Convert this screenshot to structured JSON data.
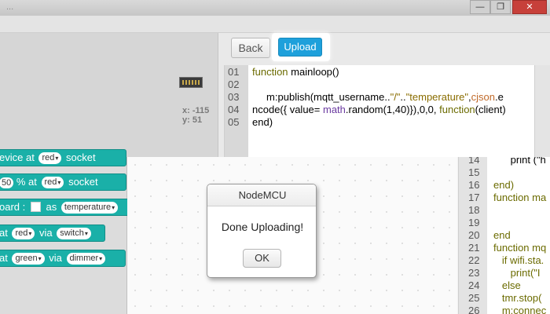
{
  "window": {
    "title": "...",
    "controls": [
      "—",
      "❐",
      "✕"
    ]
  },
  "board": {
    "coords_x": "x: -115",
    "coords_y": "y: 51"
  },
  "buttons": {
    "back": "Back",
    "upload": "Upload"
  },
  "code_top": [
    {
      "num": "01",
      "text": "function mainloop()"
    },
    {
      "num": "02",
      "text": ""
    },
    {
      "num": "03",
      "text": "     m:publish(mqtt_username..\"/\"..\"temperature\",cjson.e"
    },
    {
      "num": "04",
      "text": "ncode({ value= math.random(1,40)}),0,0, function(client)"
    },
    {
      "num": "05",
      "text": "end)"
    }
  ],
  "blocks": {
    "b1": {
      "pre": "evice  at",
      "dd1": "red",
      "post": "socket"
    },
    "b2": {
      "num": "50",
      "mid": "%  at",
      "dd1": "red",
      "post": "socket"
    },
    "b3": {
      "pre": "oard  :",
      "mid": "as",
      "dd1": "temperature"
    },
    "b4": {
      "pre": "at",
      "dd1": "red",
      "mid": "via",
      "dd2": "switch"
    },
    "b5": {
      "pre": "at",
      "dd1": "green",
      "mid": "via",
      "dd2": "dimmer"
    }
  },
  "dialog": {
    "title": "NodeMCU",
    "message": "Done Uploading!",
    "ok": "OK"
  },
  "code_right": [
    {
      "num": "14",
      "text": "      print (\"h"
    },
    {
      "num": "15",
      "text": ""
    },
    {
      "num": "16",
      "text": "end)"
    },
    {
      "num": "17",
      "text": "function ma"
    },
    {
      "num": "18",
      "text": ""
    },
    {
      "num": "19",
      "text": ""
    },
    {
      "num": "20",
      "text": "end"
    },
    {
      "num": "21",
      "text": "function mq"
    },
    {
      "num": "22",
      "text": "   if wifi.sta."
    },
    {
      "num": "23",
      "text": "      print(\"I"
    },
    {
      "num": "24",
      "text": "   else"
    },
    {
      "num": "25",
      "text": "   tmr.stop("
    },
    {
      "num": "26",
      "text": "   m:connec"
    }
  ],
  "colors": {
    "accent": "#1ea0db",
    "block": "#1ab0a8"
  }
}
